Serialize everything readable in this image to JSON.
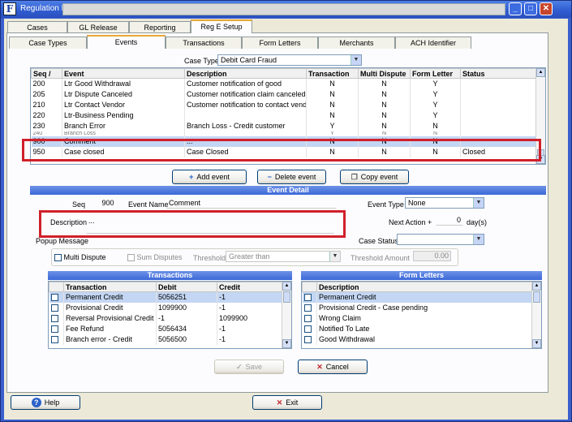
{
  "window": {
    "title": "Regulation E"
  },
  "tabs_top": [
    "Cases",
    "GL Release",
    "Reporting",
    "Reg E Setup"
  ],
  "tabs_sub": [
    "Case Types",
    "Events",
    "Transactions",
    "Form Letters",
    "Merchants",
    "ACH Identifier"
  ],
  "case_type": {
    "label": "Case Type",
    "value": "Debit Card Fraud"
  },
  "events_table": {
    "headers": [
      "Seq",
      "Event",
      "Description",
      "Transaction",
      "Multi Dispute",
      "Form Letter",
      "Status"
    ],
    "rows": [
      [
        "200",
        "Ltr Good Withdrawal",
        "Customer notification of good",
        "N",
        "N",
        "Y",
        ""
      ],
      [
        "205",
        "Ltr Dispute Canceled",
        "Customer notification claim canceled",
        "N",
        "N",
        "Y",
        ""
      ],
      [
        "210",
        "Ltr Contact Vendor",
        "Customer notification to contact vendor",
        "N",
        "N",
        "Y",
        ""
      ],
      [
        "220",
        "Ltr-Business Pending",
        "",
        "N",
        "N",
        "Y",
        ""
      ],
      [
        "230",
        "Branch Error",
        "Branch Loss - Credit customer",
        "Y",
        "N",
        "N",
        ""
      ],
      [
        "240",
        "Branch Loss",
        "",
        "Y",
        "N",
        "N",
        ""
      ],
      [
        "900",
        "Comment",
        "...",
        "N",
        "N",
        "N",
        ""
      ],
      [
        "950",
        "Case closed",
        "Case Closed",
        "N",
        "N",
        "N",
        "Closed"
      ]
    ]
  },
  "event_buttons": {
    "add": "Add event",
    "delete": "Delete event",
    "copy": "Copy event"
  },
  "event_detail": {
    "title": "Event Detail",
    "seq_label": "Seq",
    "seq_value": "900",
    "name_label": "Event Name",
    "name_value": "Comment",
    "type_label": "Event Type",
    "type_value": "None",
    "desc_label": "Description",
    "desc_value": "...",
    "next_action_label": "Next Action +",
    "next_action_value": "0",
    "days_label": "day(s)",
    "popup_label": "Popup Message",
    "status_label": "Case Status",
    "status_value": "",
    "multi_dispute_label": "Multi Dispute",
    "sum_disputes_label": "Sum Disputes",
    "threshold_label": "Threshold",
    "threshold_value": "Greater than",
    "threshold_amount_label": "Threshold Amount",
    "threshold_amount_value": "0.00"
  },
  "transactions": {
    "title": "Transactions",
    "headers": [
      "Transaction",
      "Debit",
      "Credit"
    ],
    "rows": [
      [
        "Permanent Credit",
        "5056251",
        "-1"
      ],
      [
        "Provisional Credit",
        "1099900",
        "-1"
      ],
      [
        "Reversal Provisional Credit",
        "-1",
        "1099900"
      ],
      [
        "Fee Refund",
        "5056434",
        "-1"
      ],
      [
        "Branch error - Credit",
        "5056500",
        "-1"
      ]
    ]
  },
  "form_letters": {
    "title": "Form Letters",
    "headers": [
      "Description"
    ],
    "rows": [
      "Permanent Credit",
      "Provisional Credit - Case pending",
      "Wrong Claim",
      "Notified To Late",
      "Good Withdrawal"
    ]
  },
  "actions": {
    "save": "Save",
    "cancel": "Cancel",
    "help": "Help",
    "exit": "Exit"
  }
}
